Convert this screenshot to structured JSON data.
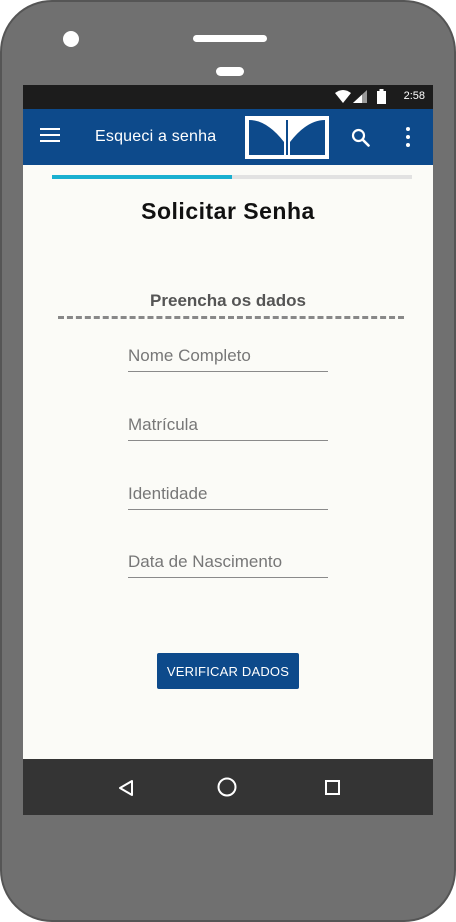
{
  "status_bar": {
    "time": "2:58",
    "icons": [
      "wifi-icon",
      "signal-icon",
      "battery-icon"
    ]
  },
  "app_bar": {
    "title": "Esqueci a senha",
    "background_color": "#0d4a8b",
    "icons": [
      "menu-icon",
      "logo",
      "search-icon",
      "more-vert-icon"
    ]
  },
  "progress": {
    "fraction": 0.5,
    "color": "#1ab0d0"
  },
  "page": {
    "title": "Solicitar Senha"
  },
  "form": {
    "section_title": "Preencha os dados",
    "fields": [
      {
        "placeholder": "Nome Completo",
        "value": ""
      },
      {
        "placeholder": "Matrícula",
        "value": ""
      },
      {
        "placeholder": "Identidade",
        "value": ""
      },
      {
        "placeholder": "Data de Nascimento",
        "value": ""
      }
    ],
    "submit_label": "VERIFICAR DADOS"
  },
  "nav_bar": {
    "icons": [
      "back-icon",
      "home-icon",
      "recent-apps-icon"
    ]
  }
}
